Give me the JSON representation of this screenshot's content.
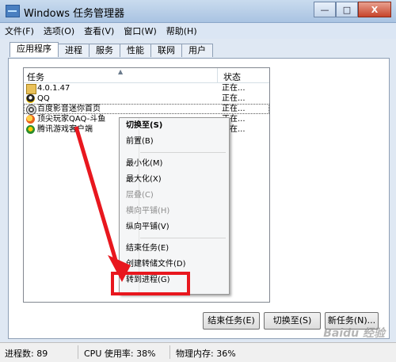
{
  "window": {
    "title": "Windows 任务管理器",
    "minimize": "—",
    "maximize": "□",
    "close": "X"
  },
  "menu": [
    "文件(F)",
    "选项(O)",
    "查看(V)",
    "窗口(W)",
    "帮助(H)"
  ],
  "tabs": [
    "应用程序",
    "进程",
    "服务",
    "性能",
    "联网",
    "用户"
  ],
  "list": {
    "columns": {
      "task": "任务",
      "status": "状态"
    },
    "rows": [
      {
        "name": "4.0.1.47",
        "status": "正在...",
        "icon": "folder-icon"
      },
      {
        "name": "QQ",
        "status": "正在...",
        "icon": "qq-icon"
      },
      {
        "name": "百度影音迷你首页",
        "status": "正在...",
        "icon": "baidu-player-icon"
      },
      {
        "name": "顶尖玩家QAQ-斗鱼",
        "status": "正在...",
        "icon": "qqlive-icon"
      },
      {
        "name": "腾讯游戏客户端",
        "status": "正在...",
        "icon": "qq-games-icon"
      }
    ]
  },
  "context_menu": {
    "switch_to": "切换至(S)",
    "bring_front": "前置(B)",
    "minimize": "最小化(M)",
    "maximize": "最大化(X)",
    "cascade": "层叠(C)",
    "tile_h": "横向平铺(H)",
    "tile_v": "纵向平铺(V)",
    "end_task": "结束任务(E)",
    "create_dump": "创建转储文件(D)",
    "goto_process": "转到进程(G)"
  },
  "buttons": {
    "end_task": "结束任务(E)",
    "switch_to": "切换至(S)",
    "new_task": "新任务(N)..."
  },
  "statusbar": {
    "processes": "进程数: 89",
    "cpu": "CPU 使用率: 38%",
    "memory": "物理内存: 36%"
  },
  "watermark": "Baidu 经验",
  "colors": {
    "highlight": "#e8171e",
    "title_bar": "#b9cfe9"
  }
}
